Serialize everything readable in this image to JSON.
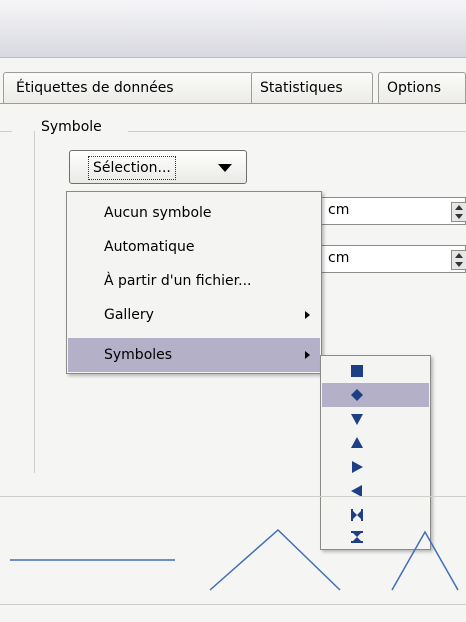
{
  "tabs": [
    {
      "label": "Étiquettes de données"
    },
    {
      "label": "Statistiques"
    },
    {
      "label": "Options"
    }
  ],
  "symbol_section": {
    "title": "Symbole",
    "selection_button_label": "Sélection..."
  },
  "fields": [
    {
      "unit": "cm"
    },
    {
      "unit": "cm"
    }
  ],
  "context_menu": {
    "items": [
      {
        "label": "Aucun symbole",
        "has_submenu": false
      },
      {
        "label": "Automatique",
        "has_submenu": false
      },
      {
        "label": "À partir d'un fichier...",
        "has_submenu": false
      },
      {
        "label": "Gallery",
        "has_submenu": true
      },
      {
        "label": "Symboles",
        "has_submenu": true,
        "highlighted": true
      }
    ]
  },
  "symbols_submenu": {
    "items": [
      {
        "name": "square-symbol-icon"
      },
      {
        "name": "diamond-symbol-icon",
        "highlighted": true
      },
      {
        "name": "triangle-down-symbol-icon"
      },
      {
        "name": "triangle-up-symbol-icon"
      },
      {
        "name": "triangle-right-symbol-icon"
      },
      {
        "name": "triangle-left-symbol-icon"
      },
      {
        "name": "bowtie-symbol-icon"
      },
      {
        "name": "hourglass-symbol-icon"
      }
    ],
    "symbol_color": "#1d3f86"
  },
  "colors": {
    "highlight": "#b3b0c8",
    "preview_line": "#3f6fb8"
  }
}
